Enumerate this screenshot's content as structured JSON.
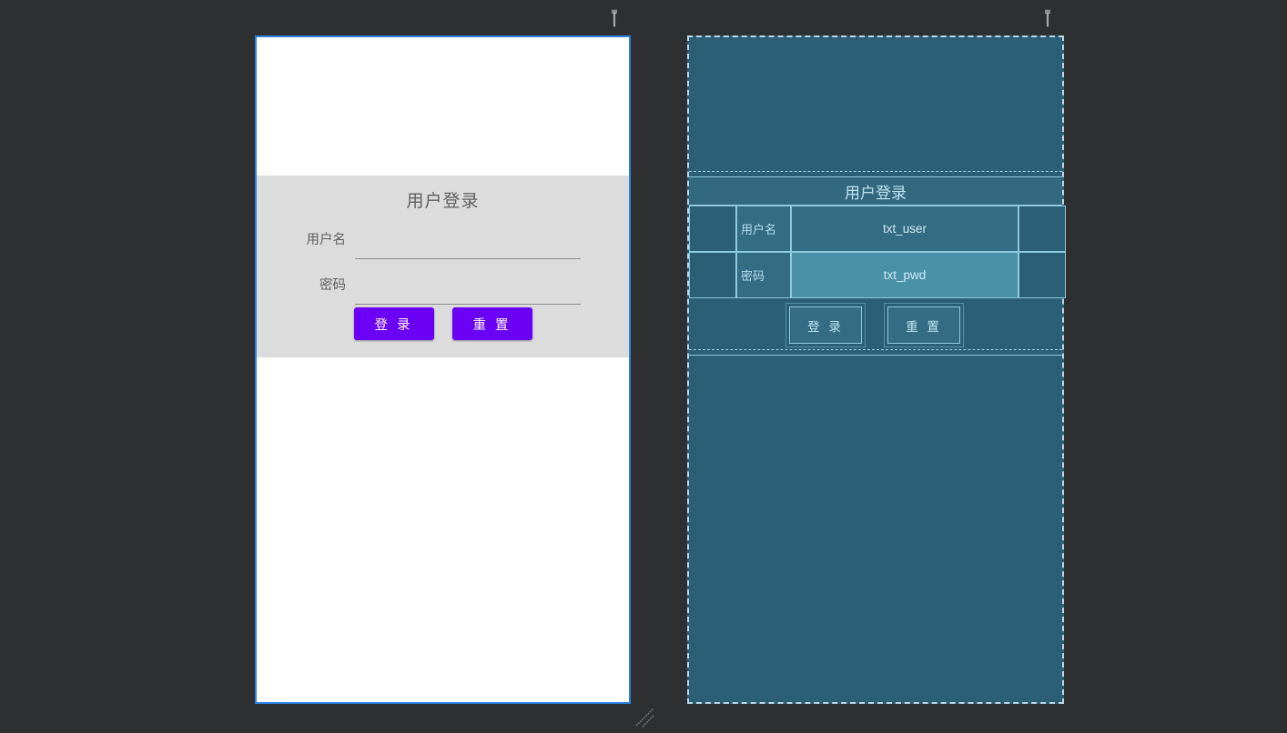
{
  "editor": {
    "background_color": "#2d2f31",
    "design_accent_color": "#2a83e4",
    "blueprint_accent_color": "#8fc9dd",
    "blueprint_background_color": "#2a5f75",
    "button_color": "#6a00f4",
    "form_panel_color": "#dcdcdc"
  },
  "design_handle": {
    "icon": "wrench-icon"
  },
  "blueprint_handle": {
    "icon": "wrench-icon"
  },
  "resize_grip": {
    "icon": "resize-grip-icon"
  },
  "design": {
    "title": "用户登录",
    "fields": [
      {
        "label": "用户名",
        "value": "",
        "placeholder": ""
      },
      {
        "label": "密码",
        "value": "",
        "placeholder": ""
      }
    ],
    "buttons": [
      {
        "label": "登 录"
      },
      {
        "label": "重 置"
      }
    ]
  },
  "blueprint": {
    "title": "用户登录",
    "rows": [
      {
        "label": "用户名",
        "component": "txt_user"
      },
      {
        "label": "密码",
        "component": "txt_pwd"
      }
    ],
    "buttons": [
      {
        "label": "登 录"
      },
      {
        "label": "重 置"
      }
    ]
  }
}
